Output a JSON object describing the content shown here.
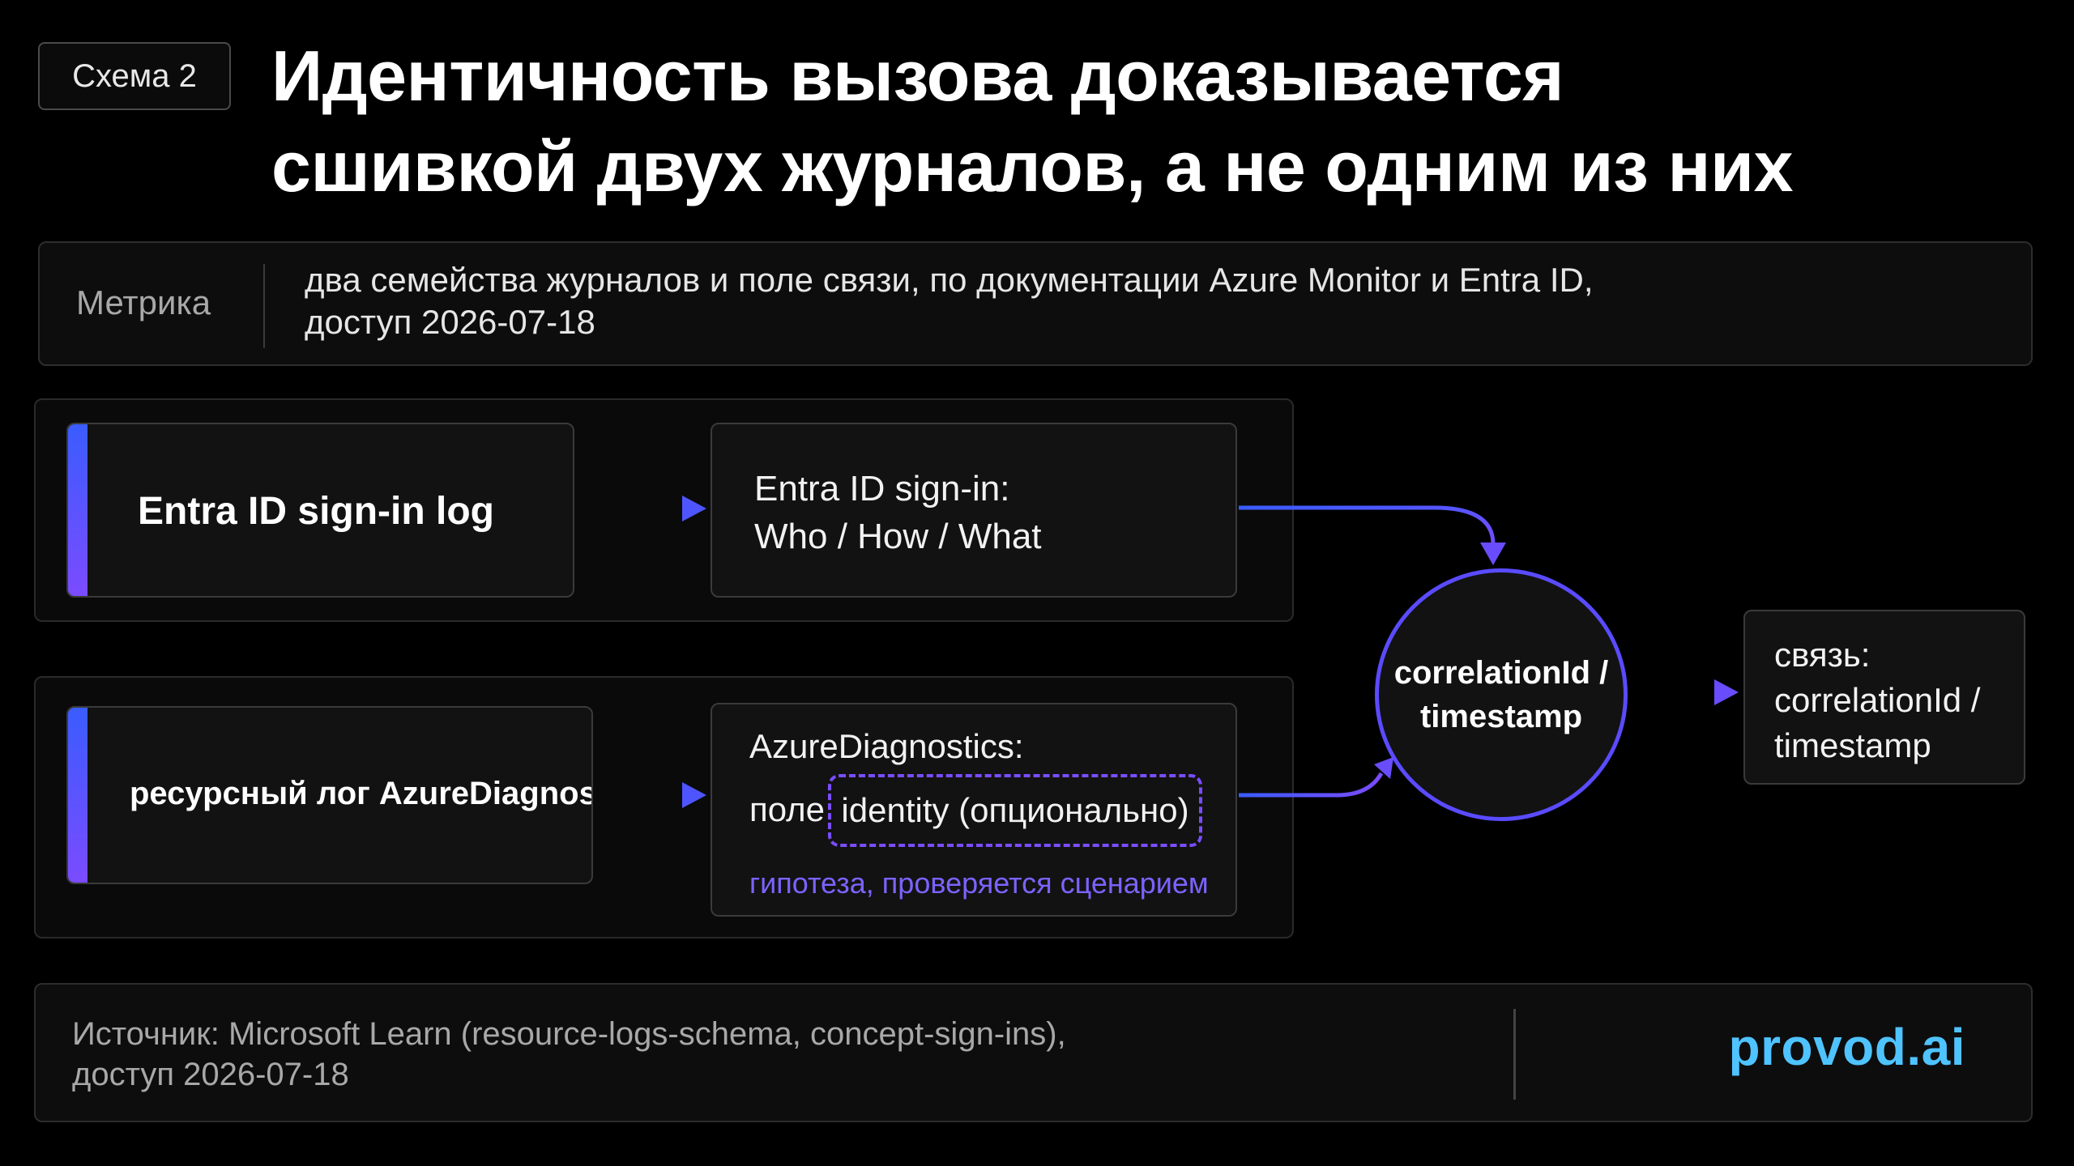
{
  "badge": "Схема 2",
  "title": {
    "line1": "Идентичность вызова доказывается",
    "line2": "сшивкой двух журналов, а не одним из них"
  },
  "metric": {
    "label": "Метрика",
    "line1": "два семейства журналов и поле связи, по документации Azure Monitor и Entra ID,",
    "line2": "доступ 2026-07-18"
  },
  "nodes": {
    "signin_log": "Entra ID sign-in log",
    "signin_detail": {
      "line1": "Entra ID sign-in:",
      "line2": "Who / How / What"
    },
    "resource_log": "ресурсный лог AzureDiagnostics",
    "diag_detail": {
      "line1": "AzureDiagnostics:",
      "prefix": "поле",
      "field": "identity (опционально)",
      "hypothesis": "гипотеза, проверяется сценарием"
    },
    "hub": {
      "line1": "correlationId /",
      "line2": "timestamp"
    },
    "output": {
      "line1": "связь:",
      "line2": "correlationId /",
      "line3": "timestamp"
    }
  },
  "colors": {
    "accent_blue": "#3a5cff",
    "accent_purple": "#7b4bff",
    "hypothesis": "#7b63ff",
    "brand": "#4fc3ff"
  },
  "footer": {
    "source_line1": "Источник: Microsoft Learn (resource-logs-schema, concept-sign-ins),",
    "source_line2": "доступ 2026-07-18",
    "brand": "provod.ai"
  }
}
